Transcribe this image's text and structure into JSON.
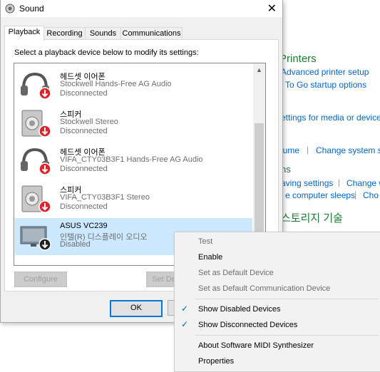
{
  "background": {
    "printers_heading": "Printers",
    "links": {
      "advanced_printer_setup": "Advanced printer setup",
      "to_go_startup": "To Go startup options",
      "settings_media": "ettings for media or devices",
      "volume": "lume",
      "change_system_sounds": "Change system s",
      "ns_heading": "ns",
      "saving_settings": "aving settings",
      "change_w": "Change w",
      "computer_sleeps": "e computer sleeps",
      "cho": "Cho"
    },
    "storage_heading": "스토리지 기술"
  },
  "dialog": {
    "title": "Sound",
    "close_glyph": "✕",
    "tabs": [
      "Playback",
      "Recording",
      "Sounds",
      "Communications"
    ],
    "instruction": "Select a playback device below to modify its settings:",
    "devices": [
      {
        "name": "헤드셋 이어폰",
        "desc": "Stockwell Hands-Free AG Audio",
        "status": "Disconnected",
        "icon": "headset-icon"
      },
      {
        "name": "스피커",
        "desc": "Stockwell Stereo",
        "status": "Disconnected",
        "icon": "speaker-icon"
      },
      {
        "name": "헤드셋 이어폰",
        "desc": "VIFA_CTY03B3F1 Hands-Free AG Audio",
        "status": "Disconnected",
        "icon": "headset-icon"
      },
      {
        "name": "스피커",
        "desc": "VIFA_CTY03B3F1 Stereo",
        "status": "Disconnected",
        "icon": "speaker-icon"
      },
      {
        "name": "ASUS VC239",
        "desc": "인텔(R) 디스플레이 오디오",
        "status": "Disabled",
        "icon": "monitor-icon"
      }
    ],
    "buttons": {
      "configure": "Configure",
      "set_default": "Set De",
      "ok": "OK"
    }
  },
  "context_menu": {
    "items": [
      {
        "label": "Test",
        "enabled": false,
        "checked": false
      },
      {
        "label": "Enable",
        "enabled": true,
        "checked": false
      },
      {
        "label": "Set as Default Device",
        "enabled": false,
        "checked": false
      },
      {
        "label": "Set as Default Communication Device",
        "enabled": false,
        "checked": false
      },
      {
        "label": "Show Disabled Devices",
        "enabled": true,
        "checked": true
      },
      {
        "label": "Show Disconnected Devices",
        "enabled": true,
        "checked": true
      },
      {
        "label": "About Software MIDI Synthesizer",
        "enabled": true,
        "checked": false
      },
      {
        "label": "Properties",
        "enabled": true,
        "checked": false
      }
    ],
    "check_glyph": "✓"
  },
  "colors": {
    "accent": "#0078d7",
    "selection": "#cce8ff",
    "link": "#0066cc",
    "heading_green": "#1e7b34",
    "disconnect_red": "#d9252b"
  }
}
